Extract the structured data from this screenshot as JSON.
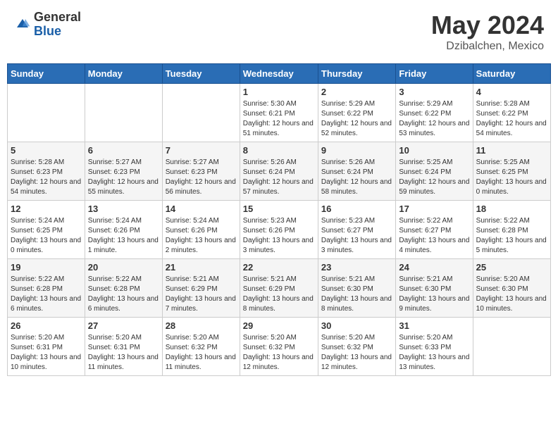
{
  "header": {
    "logo_general": "General",
    "logo_blue": "Blue",
    "month_year": "May 2024",
    "location": "Dzibalchen, Mexico"
  },
  "weekdays": [
    "Sunday",
    "Monday",
    "Tuesday",
    "Wednesday",
    "Thursday",
    "Friday",
    "Saturday"
  ],
  "weeks": [
    [
      {
        "day": "",
        "sunrise": "",
        "sunset": "",
        "daylight": ""
      },
      {
        "day": "",
        "sunrise": "",
        "sunset": "",
        "daylight": ""
      },
      {
        "day": "",
        "sunrise": "",
        "sunset": "",
        "daylight": ""
      },
      {
        "day": "1",
        "sunrise": "Sunrise: 5:30 AM",
        "sunset": "Sunset: 6:21 PM",
        "daylight": "Daylight: 12 hours and 51 minutes."
      },
      {
        "day": "2",
        "sunrise": "Sunrise: 5:29 AM",
        "sunset": "Sunset: 6:22 PM",
        "daylight": "Daylight: 12 hours and 52 minutes."
      },
      {
        "day": "3",
        "sunrise": "Sunrise: 5:29 AM",
        "sunset": "Sunset: 6:22 PM",
        "daylight": "Daylight: 12 hours and 53 minutes."
      },
      {
        "day": "4",
        "sunrise": "Sunrise: 5:28 AM",
        "sunset": "Sunset: 6:22 PM",
        "daylight": "Daylight: 12 hours and 54 minutes."
      }
    ],
    [
      {
        "day": "5",
        "sunrise": "Sunrise: 5:28 AM",
        "sunset": "Sunset: 6:23 PM",
        "daylight": "Daylight: 12 hours and 54 minutes."
      },
      {
        "day": "6",
        "sunrise": "Sunrise: 5:27 AM",
        "sunset": "Sunset: 6:23 PM",
        "daylight": "Daylight: 12 hours and 55 minutes."
      },
      {
        "day": "7",
        "sunrise": "Sunrise: 5:27 AM",
        "sunset": "Sunset: 6:23 PM",
        "daylight": "Daylight: 12 hours and 56 minutes."
      },
      {
        "day": "8",
        "sunrise": "Sunrise: 5:26 AM",
        "sunset": "Sunset: 6:24 PM",
        "daylight": "Daylight: 12 hours and 57 minutes."
      },
      {
        "day": "9",
        "sunrise": "Sunrise: 5:26 AM",
        "sunset": "Sunset: 6:24 PM",
        "daylight": "Daylight: 12 hours and 58 minutes."
      },
      {
        "day": "10",
        "sunrise": "Sunrise: 5:25 AM",
        "sunset": "Sunset: 6:24 PM",
        "daylight": "Daylight: 12 hours and 59 minutes."
      },
      {
        "day": "11",
        "sunrise": "Sunrise: 5:25 AM",
        "sunset": "Sunset: 6:25 PM",
        "daylight": "Daylight: 13 hours and 0 minutes."
      }
    ],
    [
      {
        "day": "12",
        "sunrise": "Sunrise: 5:24 AM",
        "sunset": "Sunset: 6:25 PM",
        "daylight": "Daylight: 13 hours and 0 minutes."
      },
      {
        "day": "13",
        "sunrise": "Sunrise: 5:24 AM",
        "sunset": "Sunset: 6:26 PM",
        "daylight": "Daylight: 13 hours and 1 minute."
      },
      {
        "day": "14",
        "sunrise": "Sunrise: 5:24 AM",
        "sunset": "Sunset: 6:26 PM",
        "daylight": "Daylight: 13 hours and 2 minutes."
      },
      {
        "day": "15",
        "sunrise": "Sunrise: 5:23 AM",
        "sunset": "Sunset: 6:26 PM",
        "daylight": "Daylight: 13 hours and 3 minutes."
      },
      {
        "day": "16",
        "sunrise": "Sunrise: 5:23 AM",
        "sunset": "Sunset: 6:27 PM",
        "daylight": "Daylight: 13 hours and 3 minutes."
      },
      {
        "day": "17",
        "sunrise": "Sunrise: 5:22 AM",
        "sunset": "Sunset: 6:27 PM",
        "daylight": "Daylight: 13 hours and 4 minutes."
      },
      {
        "day": "18",
        "sunrise": "Sunrise: 5:22 AM",
        "sunset": "Sunset: 6:28 PM",
        "daylight": "Daylight: 13 hours and 5 minutes."
      }
    ],
    [
      {
        "day": "19",
        "sunrise": "Sunrise: 5:22 AM",
        "sunset": "Sunset: 6:28 PM",
        "daylight": "Daylight: 13 hours and 6 minutes."
      },
      {
        "day": "20",
        "sunrise": "Sunrise: 5:22 AM",
        "sunset": "Sunset: 6:28 PM",
        "daylight": "Daylight: 13 hours and 6 minutes."
      },
      {
        "day": "21",
        "sunrise": "Sunrise: 5:21 AM",
        "sunset": "Sunset: 6:29 PM",
        "daylight": "Daylight: 13 hours and 7 minutes."
      },
      {
        "day": "22",
        "sunrise": "Sunrise: 5:21 AM",
        "sunset": "Sunset: 6:29 PM",
        "daylight": "Daylight: 13 hours and 8 minutes."
      },
      {
        "day": "23",
        "sunrise": "Sunrise: 5:21 AM",
        "sunset": "Sunset: 6:30 PM",
        "daylight": "Daylight: 13 hours and 8 minutes."
      },
      {
        "day": "24",
        "sunrise": "Sunrise: 5:21 AM",
        "sunset": "Sunset: 6:30 PM",
        "daylight": "Daylight: 13 hours and 9 minutes."
      },
      {
        "day": "25",
        "sunrise": "Sunrise: 5:20 AM",
        "sunset": "Sunset: 6:30 PM",
        "daylight": "Daylight: 13 hours and 10 minutes."
      }
    ],
    [
      {
        "day": "26",
        "sunrise": "Sunrise: 5:20 AM",
        "sunset": "Sunset: 6:31 PM",
        "daylight": "Daylight: 13 hours and 10 minutes."
      },
      {
        "day": "27",
        "sunrise": "Sunrise: 5:20 AM",
        "sunset": "Sunset: 6:31 PM",
        "daylight": "Daylight: 13 hours and 11 minutes."
      },
      {
        "day": "28",
        "sunrise": "Sunrise: 5:20 AM",
        "sunset": "Sunset: 6:32 PM",
        "daylight": "Daylight: 13 hours and 11 minutes."
      },
      {
        "day": "29",
        "sunrise": "Sunrise: 5:20 AM",
        "sunset": "Sunset: 6:32 PM",
        "daylight": "Daylight: 13 hours and 12 minutes."
      },
      {
        "day": "30",
        "sunrise": "Sunrise: 5:20 AM",
        "sunset": "Sunset: 6:32 PM",
        "daylight": "Daylight: 13 hours and 12 minutes."
      },
      {
        "day": "31",
        "sunrise": "Sunrise: 5:20 AM",
        "sunset": "Sunset: 6:33 PM",
        "daylight": "Daylight: 13 hours and 13 minutes."
      },
      {
        "day": "",
        "sunrise": "",
        "sunset": "",
        "daylight": ""
      }
    ]
  ]
}
